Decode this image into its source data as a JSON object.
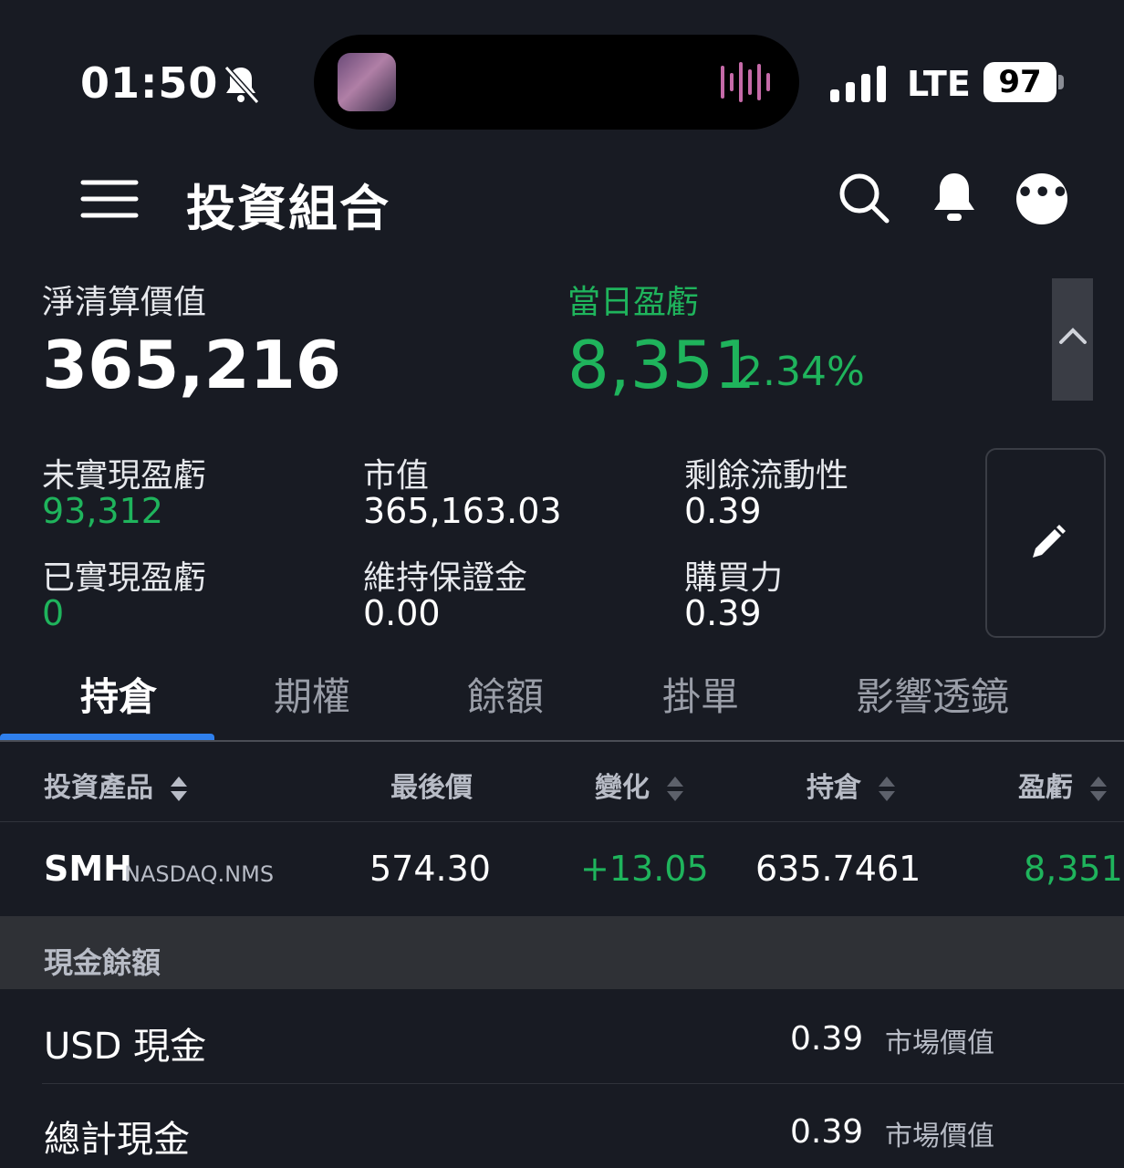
{
  "status": {
    "time": "01:50",
    "network": "LTE",
    "battery": "97"
  },
  "header": {
    "title": "投資組合"
  },
  "summary": {
    "net_label": "淨清算價值",
    "net_value": "365,216",
    "daily_label": "當日盈虧",
    "daily_value": "8,351",
    "daily_pct": "2.34%"
  },
  "stats": {
    "unrealized_label": "未實現盈虧",
    "unrealized_value": "93,312",
    "market_label": "市值",
    "market_value": "365,163.03",
    "liquidity_label": "剩餘流動性",
    "liquidity_value": "0.39",
    "realized_label": "已實現盈虧",
    "realized_value": "0",
    "maintenance_label": "維持保證金",
    "maintenance_value": "0.00",
    "buying_label": "購買力",
    "buying_value": "0.39"
  },
  "tabs": [
    "持倉",
    "期權",
    "餘額",
    "掛單",
    "影響透鏡"
  ],
  "table": {
    "headers": [
      "投資產品",
      "最後價",
      "變化",
      "持倉",
      "盈虧"
    ],
    "rows": [
      {
        "symbol": "SMH",
        "exchange": "NASDAQ.NMS",
        "last": "574.30",
        "change": "+13.05",
        "position": "635.7461",
        "pnl": "8,351"
      }
    ]
  },
  "cash": {
    "section_title": "現金餘額",
    "items": [
      {
        "label": "USD 現金",
        "value": "0.39",
        "tag": "市場價值"
      },
      {
        "label": "總計現金",
        "value": "0.39",
        "tag": "市場價值"
      }
    ]
  },
  "colors": {
    "background": "#181b23",
    "positive": "#1fb45c",
    "accent": "#2f80ed"
  }
}
